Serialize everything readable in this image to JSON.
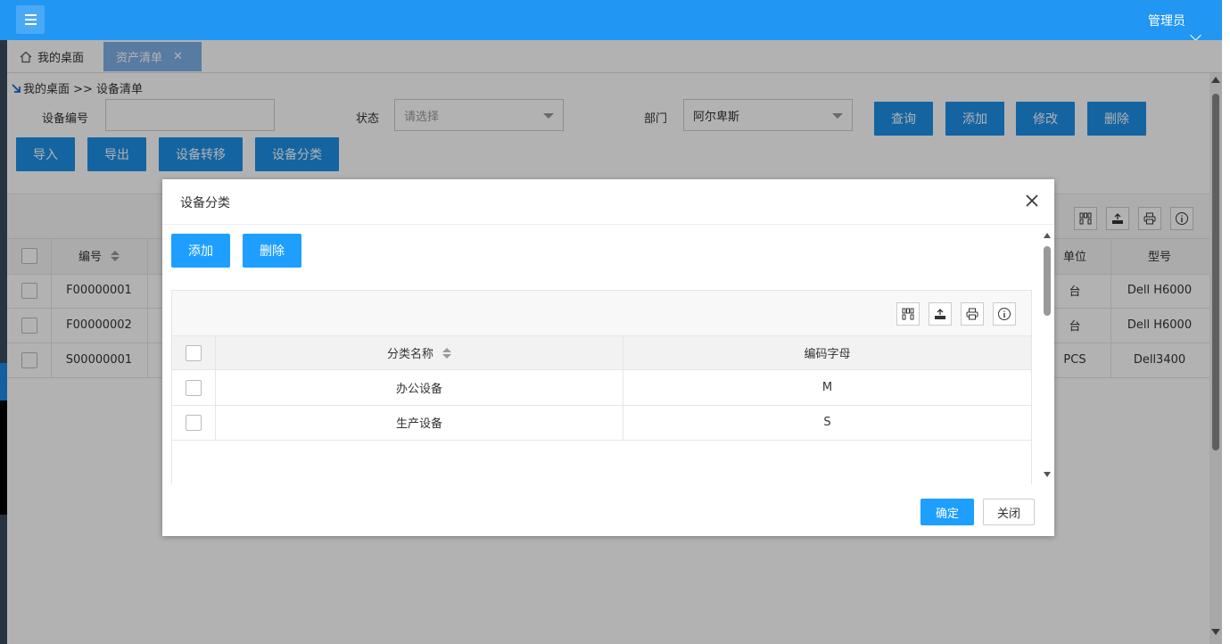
{
  "header": {
    "admin_label": "管理员",
    "menu_icon": "menu-icon",
    "accent": "#2196f3"
  },
  "tabs": [
    {
      "label": "我的桌面",
      "icon": "home-icon"
    },
    {
      "label": "资产清单",
      "close": "✕"
    }
  ],
  "breadcrumb": "我的桌面 >> 设备清单",
  "filters": {
    "code_label": "设备编号",
    "code_value": "",
    "status_label": "状态",
    "status_placeholder": "请选择",
    "dept_label": "部门",
    "dept_value": "阿尔卑斯"
  },
  "toolbar": {
    "query": "查询",
    "add": "添加",
    "edit": "修改",
    "delete": "删除",
    "import": "导入",
    "export": "导出",
    "transfer": "设备转移",
    "category": "设备分类"
  },
  "main_table": {
    "headers": {
      "code": "编号",
      "unit": "单位",
      "model": "型号"
    },
    "rows": [
      {
        "code": "F00000001",
        "unit": "台",
        "model": "Dell H6000"
      },
      {
        "code": "F00000002",
        "unit": "台",
        "model": "Dell H6000"
      },
      {
        "code": "S00000001",
        "unit": "PCS",
        "model": "Dell3400"
      }
    ]
  },
  "dialog": {
    "title": "设备分类",
    "add": "添加",
    "delete": "删除",
    "headers": {
      "name": "分类名称",
      "letter": "编码字母"
    },
    "rows": [
      {
        "name": "办公设备",
        "letter": "M"
      },
      {
        "name": "生产设备",
        "letter": "S"
      }
    ],
    "ok": "确定",
    "close": "关闭"
  }
}
